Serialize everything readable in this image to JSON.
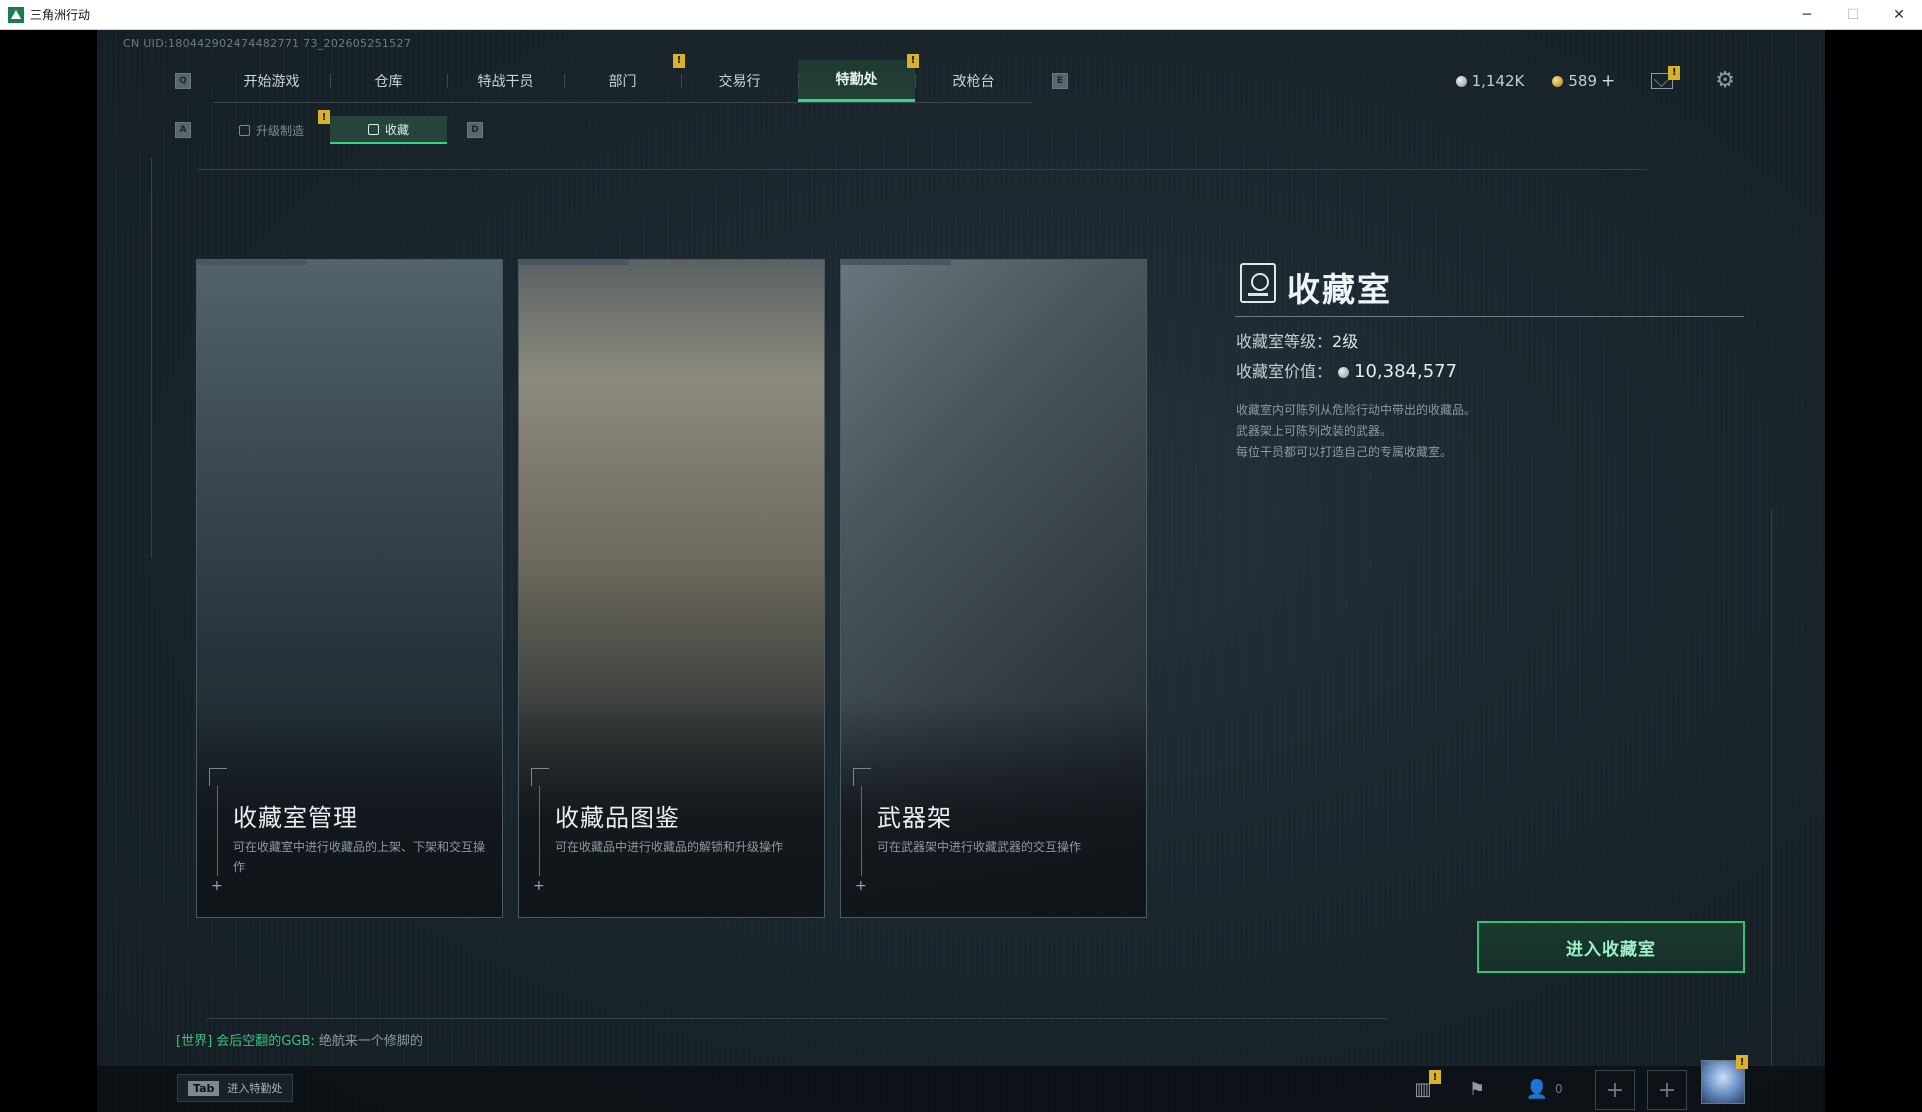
{
  "window": {
    "title": "三角洲行动",
    "controls": [
      "─",
      "☐",
      "✕"
    ]
  },
  "uid": "CN UID:180442902474482771 73_202605251527",
  "nav": {
    "left_key": "Q",
    "right_key": "E",
    "tabs": [
      {
        "label": "开始游戏",
        "badge": ""
      },
      {
        "label": "仓库",
        "badge": ""
      },
      {
        "label": "特战干员",
        "badge": ""
      },
      {
        "label": "部门",
        "badge": "!"
      },
      {
        "label": "交易行",
        "badge": ""
      },
      {
        "label": "特勤处",
        "badge": "!",
        "active": true
      },
      {
        "label": "改枪台",
        "badge": ""
      }
    ]
  },
  "currency": {
    "silver": "1,142K",
    "gold": "589",
    "add": "+",
    "mail_badge": "!"
  },
  "subnav": {
    "left_key": "A",
    "right_key": "D",
    "tabs": [
      {
        "label": "升级制造",
        "badge": "!"
      },
      {
        "label": "收藏",
        "badge": "",
        "active": true
      }
    ]
  },
  "cards": [
    {
      "title": "收藏室管理",
      "desc": "可在收藏室中进行收藏品的上架、下架和交互操作"
    },
    {
      "title": "收藏品图鉴",
      "desc": "可在收藏品中进行收藏品的解锁和升级操作"
    },
    {
      "title": "武器架",
      "desc": "可在武器架中进行收藏武器的交互操作"
    }
  ],
  "info": {
    "title": "收藏室",
    "level_label": "收藏室等级：",
    "level_value": "2级",
    "value_label": "收藏室价值：",
    "value_amount": "10,384,577",
    "desc_lines": [
      "收藏室内可陈列从危险行动中带出的收藏品。",
      "武器架上可陈列改装的武器。",
      "每位干员都可以打造自己的专属收藏室。"
    ]
  },
  "enter_button": "进入收藏室",
  "chat": {
    "channel": "[世界]",
    "sender": "会后空翻的GGB:",
    "message": "绝航来一个修脚的"
  },
  "bottombar": {
    "tab_key": "Tab",
    "tab_label": "进入特勤处",
    "friend_count": "0",
    "stats_badge": "!",
    "avatar_badge": "!"
  }
}
